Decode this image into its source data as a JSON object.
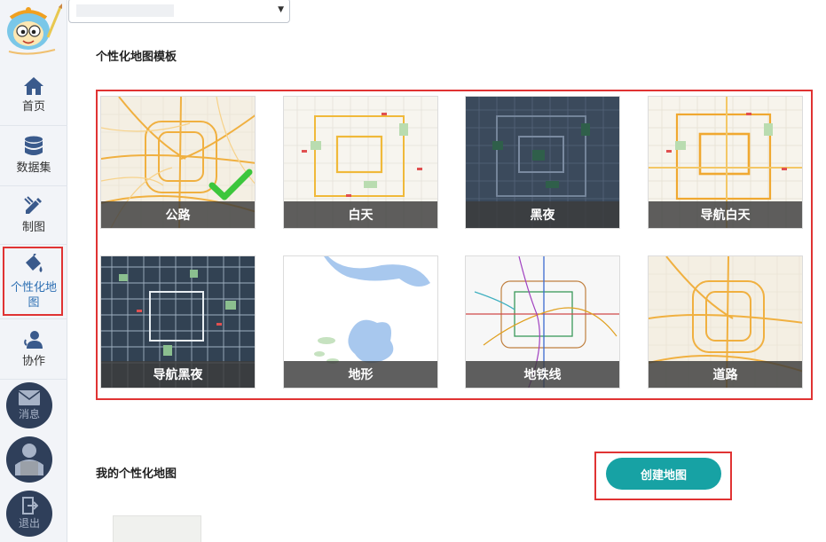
{
  "sidebar": {
    "items": [
      {
        "label": "首页",
        "icon": "home-icon"
      },
      {
        "label": "数据集",
        "icon": "database-icon"
      },
      {
        "label": "制图",
        "icon": "pen-ruler-icon"
      },
      {
        "label": "个性化地图",
        "icon": "paint-bucket-icon"
      },
      {
        "label": "协作",
        "icon": "user-collab-icon"
      }
    ],
    "active_index": 3,
    "circle_buttons": [
      {
        "label": "消息",
        "icon": "envelope-icon"
      },
      {
        "label": "",
        "icon": "avatar-icon"
      },
      {
        "label": "退出",
        "icon": "logout-icon"
      }
    ]
  },
  "header": {
    "dropdown_value": ""
  },
  "templates_section": {
    "title": "个性化地图模板",
    "selected_index": 0,
    "templates": [
      {
        "label": "公路",
        "style": "highway",
        "selected": true
      },
      {
        "label": "白天",
        "style": "day",
        "selected": false
      },
      {
        "label": "黑夜",
        "style": "night",
        "selected": false
      },
      {
        "label": "导航白天",
        "style": "nav-day",
        "selected": false
      },
      {
        "label": "导航黑夜",
        "style": "nav-night",
        "selected": false
      },
      {
        "label": "地形",
        "style": "terrain",
        "selected": false
      },
      {
        "label": "地铁线",
        "style": "subway",
        "selected": false
      },
      {
        "label": "道路",
        "style": "road",
        "selected": false
      }
    ]
  },
  "my_maps_section": {
    "title": "我的个性化地图",
    "create_button_label": "创建地图"
  },
  "colors": {
    "accent": "#17a2a4",
    "highlight_border": "#e03333",
    "check_green": "#3cc63c",
    "sidebar_bg": "#f2f4f8",
    "circle_bg": "#2f3f5a"
  }
}
